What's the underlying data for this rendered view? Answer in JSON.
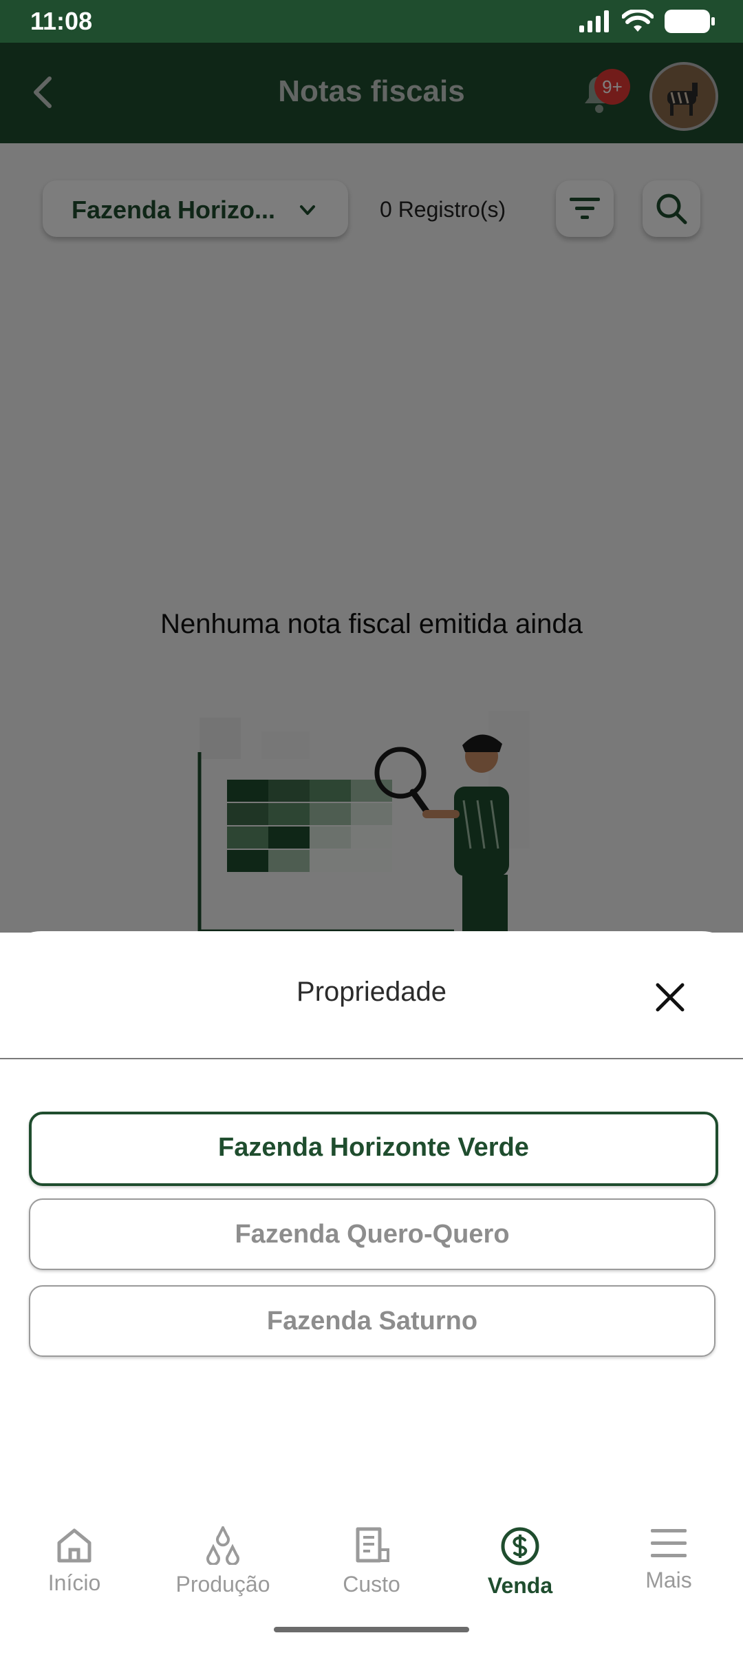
{
  "status": {
    "time": "11:08"
  },
  "header": {
    "title": "Notas fiscais",
    "notification_badge": "9+"
  },
  "filters": {
    "farm_selected": "Fazenda Horizo...",
    "records_count": "0 Registro(s)"
  },
  "empty_state": {
    "message": "Nenhuma nota fiscal emitida ainda"
  },
  "sheet": {
    "title": "Propriedade",
    "options": [
      {
        "label": "Fazenda Horizonte Verde",
        "selected": true
      },
      {
        "label": "Fazenda Quero-Quero",
        "selected": false
      },
      {
        "label": "Fazenda Saturno",
        "selected": false
      }
    ]
  },
  "nav": {
    "items": [
      {
        "label": "Início",
        "icon": "home-icon"
      },
      {
        "label": "Produção",
        "icon": "drops-icon"
      },
      {
        "label": "Custo",
        "icon": "receipt-icon"
      },
      {
        "label": "Venda",
        "icon": "dollar-icon",
        "active": true
      },
      {
        "label": "Mais",
        "icon": "menu-icon"
      }
    ]
  },
  "colors": {
    "brand": "#1f4d2e",
    "badge": "#e53935"
  }
}
